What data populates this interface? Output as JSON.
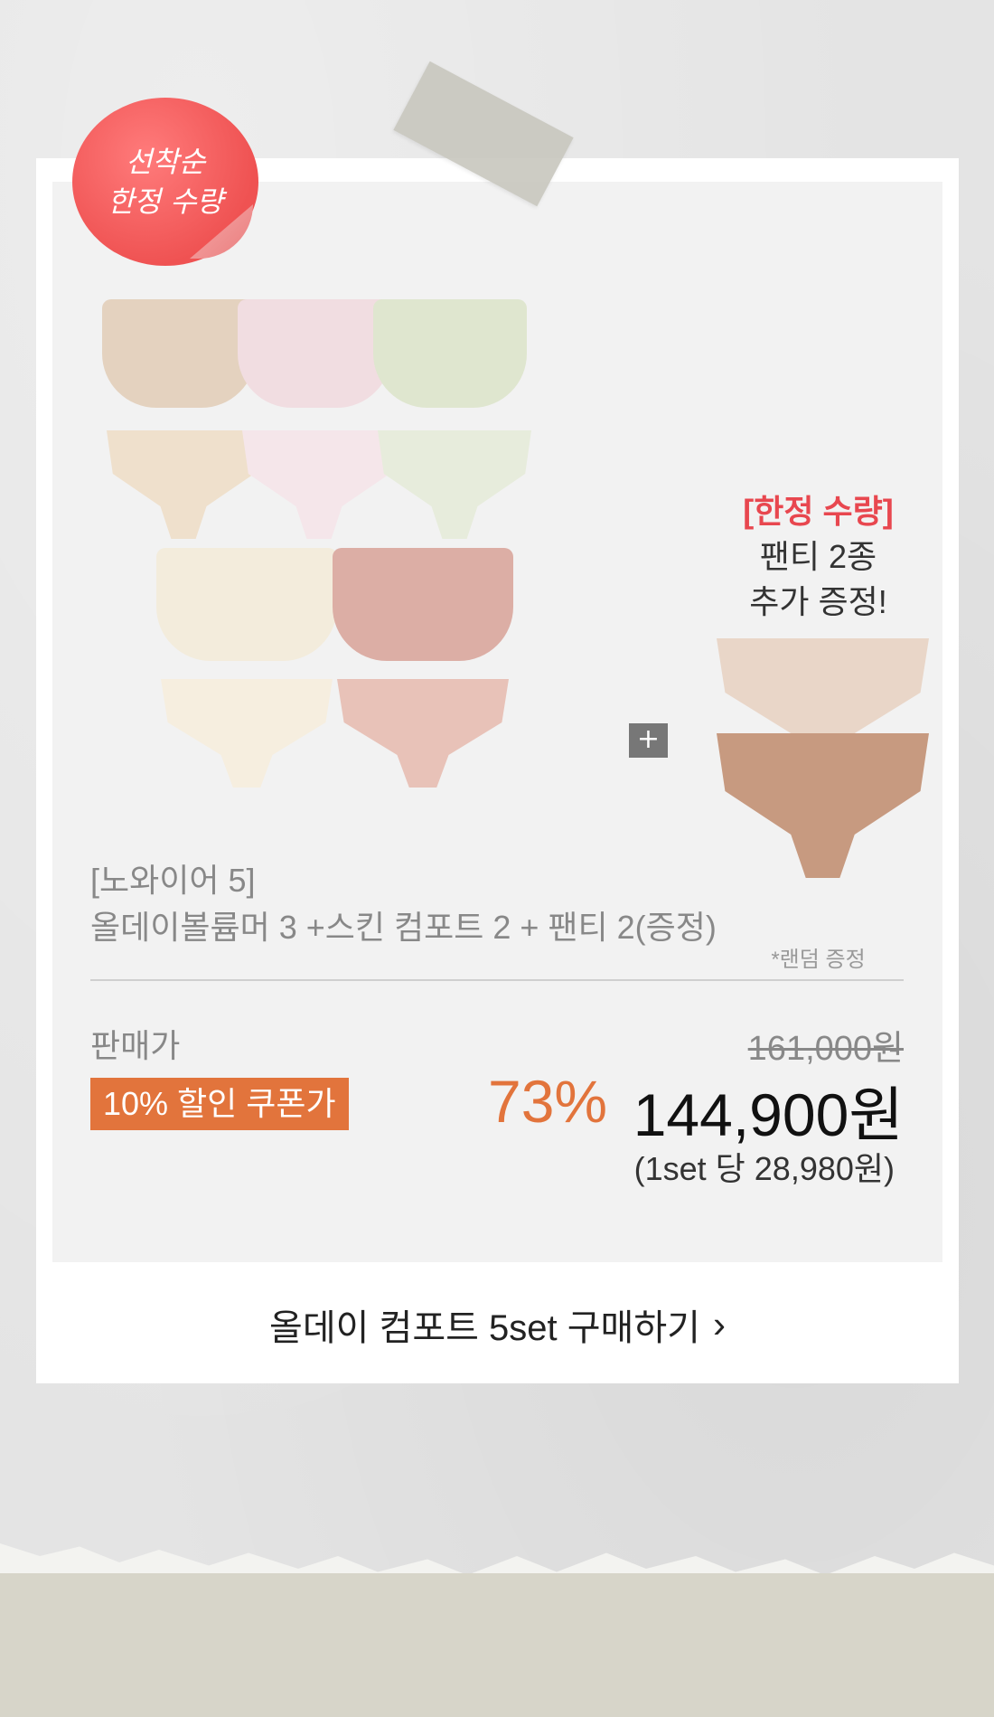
{
  "badge": {
    "line1": "선착순",
    "line2": "한정 수량"
  },
  "gift": {
    "tag": "[한정 수량]",
    "line1": "팬티 2종",
    "line2": "추가 증정!",
    "note": "*랜덤 증정"
  },
  "plus_icon": "plus-icon",
  "product": {
    "brand": "[노와이어 5]",
    "name": "올데이볼륨머 3 +스킨 컴포트 2 + 팬티 2(증정)"
  },
  "price": {
    "label": "판매가",
    "original": "161,000원",
    "coupon_label": "10% 할인 쿠폰가",
    "discount": "73%",
    "final": "144,900원",
    "per_set": "(1set 당 28,980원)"
  },
  "cta": {
    "label": "올데이 컴포트 5set 구매하기",
    "chevron": "chevron-right-icon"
  },
  "colors": {
    "accent": "#e2743c",
    "badge": "#ef5252",
    "gift_tag": "#e8474f"
  }
}
